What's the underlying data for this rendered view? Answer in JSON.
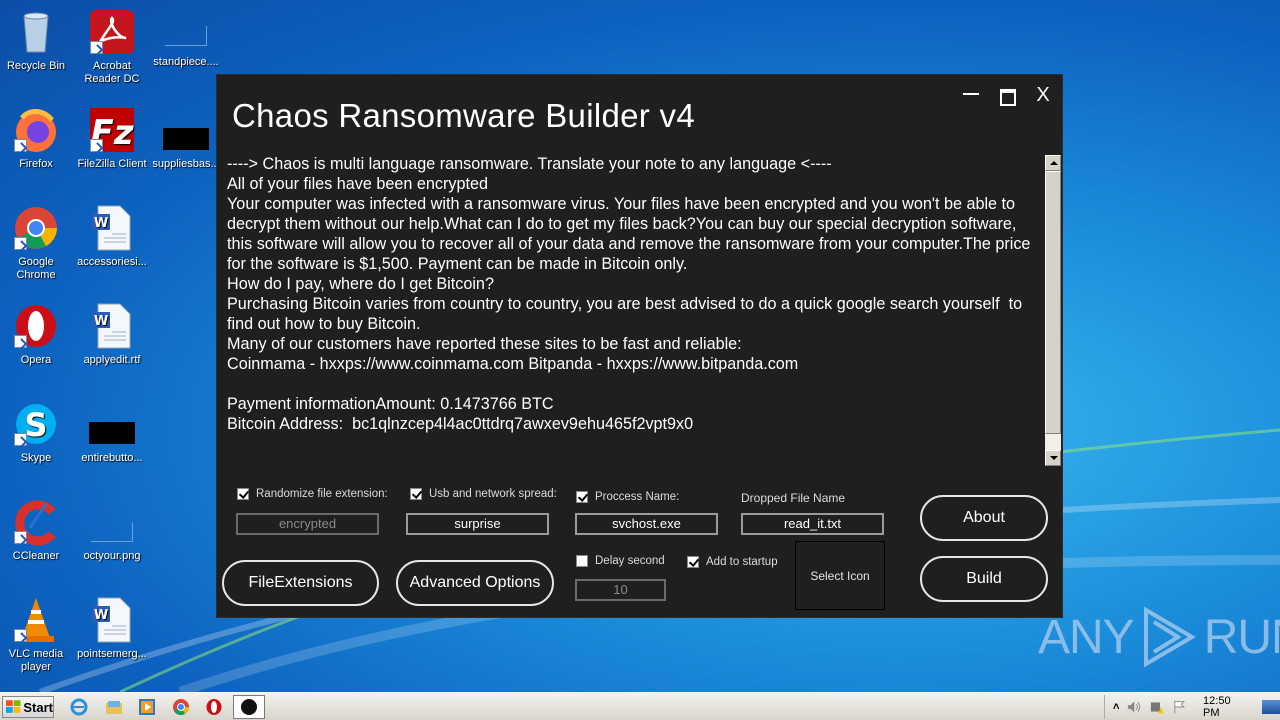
{
  "desktop": {
    "icons": [
      {
        "label": "Recycle Bin",
        "icon": "recycle-bin-icon"
      },
      {
        "label": "Acrobat Reader DC",
        "icon": "acrobat-icon"
      },
      {
        "label": "standpiece....",
        "icon": "image-file-icon"
      },
      {
        "label": "Firefox",
        "icon": "firefox-icon"
      },
      {
        "label": "FileZilla Client",
        "icon": "filezilla-icon"
      },
      {
        "label": "suppliesbas...",
        "icon": "black-image-icon"
      },
      {
        "label": "Google Chrome",
        "icon": "chrome-icon"
      },
      {
        "label": "accessoriesi...",
        "icon": "word-doc-icon"
      },
      {
        "label": "Opera",
        "icon": "opera-icon"
      },
      {
        "label": "applyedit.rtf",
        "icon": "word-doc-icon"
      },
      {
        "label": "Skype",
        "icon": "skype-icon"
      },
      {
        "label": "entirebutto...",
        "icon": "black-image-icon"
      },
      {
        "label": "CCleaner",
        "icon": "ccleaner-icon"
      },
      {
        "label": "octyour.png",
        "icon": "image-file-icon"
      },
      {
        "label": "VLC media player",
        "icon": "vlc-icon"
      },
      {
        "label": "pointsemerg...",
        "icon": "word-doc-icon"
      }
    ]
  },
  "window": {
    "title": "Chaos Ransomware Builder v4",
    "controls": {
      "minimize": "minimize",
      "maximize": "maximize",
      "close": "X"
    },
    "note_text": "----> Chaos is multi language ransomware. Translate your note to any language <----\nAll of your files have been encrypted\nYour computer was infected with a ransomware virus. Your files have been encrypted and you won't be able to decrypt them without our help.What can I do to get my files back?You can buy our special decryption software, this software will allow you to recover all of your data and remove the ransomware from your computer.The price for the software is $1,500. Payment can be made in Bitcoin only.\nHow do I pay, where do I get Bitcoin?\nPurchasing Bitcoin varies from country to country, you are best advised to do a quick google search yourself  to find out how to buy Bitcoin.\nMany of our customers have reported these sites to be fast and reliable:\nCoinmama - hxxps://www.coinmama.com Bitpanda - hxxps://www.bitpanda.com\n\nPayment informationAmount: 0.1473766 BTC\nBitcoin Address:  bc1qlnzcep4l4ac0ttdrq7awxev9ehu465f2vpt9x0",
    "options": {
      "randomize_ext": {
        "label": "Randomize file extension:",
        "checked": true,
        "value": "encrypted"
      },
      "usb_spread": {
        "label": "Usb and network spread:",
        "checked": true,
        "value": "surprise"
      },
      "process_name": {
        "label": "Proccess Name:",
        "checked": true,
        "value": "svchost.exe"
      },
      "dropped_file": {
        "label": "Dropped File Name",
        "value": "read_it.txt"
      },
      "delay": {
        "label": "Delay second",
        "checked": false,
        "value": "10"
      },
      "startup": {
        "label": "Add to startup",
        "checked": true
      }
    },
    "buttons": {
      "file_extensions": "FileExtensions",
      "advanced_options": "Advanced Options",
      "select_icon": "Select Icon",
      "about": "About",
      "build": "Build"
    }
  },
  "watermark": {
    "left": "ANY",
    "right": "RUN"
  },
  "taskbar": {
    "start_label": "Start",
    "pinned": [
      "internet-explorer-icon",
      "file-explorer-icon",
      "media-player-icon",
      "chrome-icon",
      "opera-icon",
      "chaos-app-icon"
    ],
    "clock": "12:50 PM"
  }
}
